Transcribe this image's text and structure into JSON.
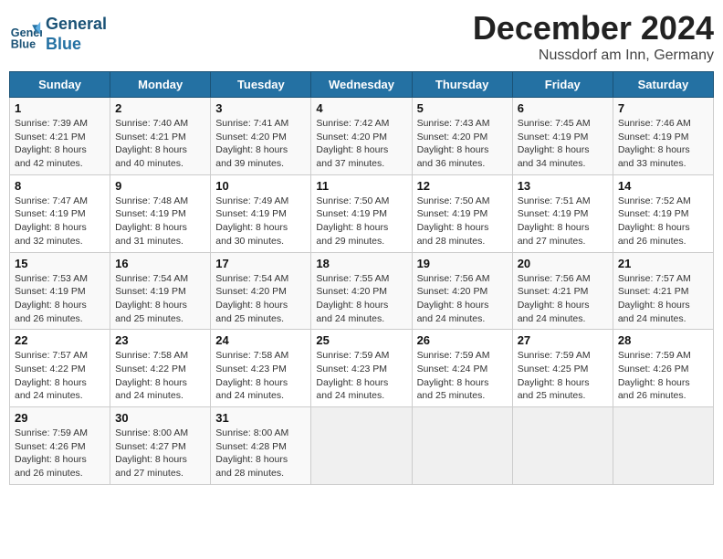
{
  "header": {
    "logo_line1": "General",
    "logo_line2": "Blue",
    "month": "December 2024",
    "location": "Nussdorf am Inn, Germany"
  },
  "weekdays": [
    "Sunday",
    "Monday",
    "Tuesday",
    "Wednesday",
    "Thursday",
    "Friday",
    "Saturday"
  ],
  "weeks": [
    [
      {
        "day": 1,
        "sunrise": "7:39 AM",
        "sunset": "4:21 PM",
        "daylight": "8 hours and 42 minutes."
      },
      {
        "day": 2,
        "sunrise": "7:40 AM",
        "sunset": "4:21 PM",
        "daylight": "8 hours and 40 minutes."
      },
      {
        "day": 3,
        "sunrise": "7:41 AM",
        "sunset": "4:20 PM",
        "daylight": "8 hours and 39 minutes."
      },
      {
        "day": 4,
        "sunrise": "7:42 AM",
        "sunset": "4:20 PM",
        "daylight": "8 hours and 37 minutes."
      },
      {
        "day": 5,
        "sunrise": "7:43 AM",
        "sunset": "4:20 PM",
        "daylight": "8 hours and 36 minutes."
      },
      {
        "day": 6,
        "sunrise": "7:45 AM",
        "sunset": "4:19 PM",
        "daylight": "8 hours and 34 minutes."
      },
      {
        "day": 7,
        "sunrise": "7:46 AM",
        "sunset": "4:19 PM",
        "daylight": "8 hours and 33 minutes."
      }
    ],
    [
      {
        "day": 8,
        "sunrise": "7:47 AM",
        "sunset": "4:19 PM",
        "daylight": "8 hours and 32 minutes."
      },
      {
        "day": 9,
        "sunrise": "7:48 AM",
        "sunset": "4:19 PM",
        "daylight": "8 hours and 31 minutes."
      },
      {
        "day": 10,
        "sunrise": "7:49 AM",
        "sunset": "4:19 PM",
        "daylight": "8 hours and 30 minutes."
      },
      {
        "day": 11,
        "sunrise": "7:50 AM",
        "sunset": "4:19 PM",
        "daylight": "8 hours and 29 minutes."
      },
      {
        "day": 12,
        "sunrise": "7:50 AM",
        "sunset": "4:19 PM",
        "daylight": "8 hours and 28 minutes."
      },
      {
        "day": 13,
        "sunrise": "7:51 AM",
        "sunset": "4:19 PM",
        "daylight": "8 hours and 27 minutes."
      },
      {
        "day": 14,
        "sunrise": "7:52 AM",
        "sunset": "4:19 PM",
        "daylight": "8 hours and 26 minutes."
      }
    ],
    [
      {
        "day": 15,
        "sunrise": "7:53 AM",
        "sunset": "4:19 PM",
        "daylight": "8 hours and 26 minutes."
      },
      {
        "day": 16,
        "sunrise": "7:54 AM",
        "sunset": "4:19 PM",
        "daylight": "8 hours and 25 minutes."
      },
      {
        "day": 17,
        "sunrise": "7:54 AM",
        "sunset": "4:20 PM",
        "daylight": "8 hours and 25 minutes."
      },
      {
        "day": 18,
        "sunrise": "7:55 AM",
        "sunset": "4:20 PM",
        "daylight": "8 hours and 24 minutes."
      },
      {
        "day": 19,
        "sunrise": "7:56 AM",
        "sunset": "4:20 PM",
        "daylight": "8 hours and 24 minutes."
      },
      {
        "day": 20,
        "sunrise": "7:56 AM",
        "sunset": "4:21 PM",
        "daylight": "8 hours and 24 minutes."
      },
      {
        "day": 21,
        "sunrise": "7:57 AM",
        "sunset": "4:21 PM",
        "daylight": "8 hours and 24 minutes."
      }
    ],
    [
      {
        "day": 22,
        "sunrise": "7:57 AM",
        "sunset": "4:22 PM",
        "daylight": "8 hours and 24 minutes."
      },
      {
        "day": 23,
        "sunrise": "7:58 AM",
        "sunset": "4:22 PM",
        "daylight": "8 hours and 24 minutes."
      },
      {
        "day": 24,
        "sunrise": "7:58 AM",
        "sunset": "4:23 PM",
        "daylight": "8 hours and 24 minutes."
      },
      {
        "day": 25,
        "sunrise": "7:59 AM",
        "sunset": "4:23 PM",
        "daylight": "8 hours and 24 minutes."
      },
      {
        "day": 26,
        "sunrise": "7:59 AM",
        "sunset": "4:24 PM",
        "daylight": "8 hours and 25 minutes."
      },
      {
        "day": 27,
        "sunrise": "7:59 AM",
        "sunset": "4:25 PM",
        "daylight": "8 hours and 25 minutes."
      },
      {
        "day": 28,
        "sunrise": "7:59 AM",
        "sunset": "4:26 PM",
        "daylight": "8 hours and 26 minutes."
      }
    ],
    [
      {
        "day": 29,
        "sunrise": "7:59 AM",
        "sunset": "4:26 PM",
        "daylight": "8 hours and 26 minutes."
      },
      {
        "day": 30,
        "sunrise": "8:00 AM",
        "sunset": "4:27 PM",
        "daylight": "8 hours and 27 minutes."
      },
      {
        "day": 31,
        "sunrise": "8:00 AM",
        "sunset": "4:28 PM",
        "daylight": "8 hours and 28 minutes."
      },
      null,
      null,
      null,
      null
    ]
  ]
}
